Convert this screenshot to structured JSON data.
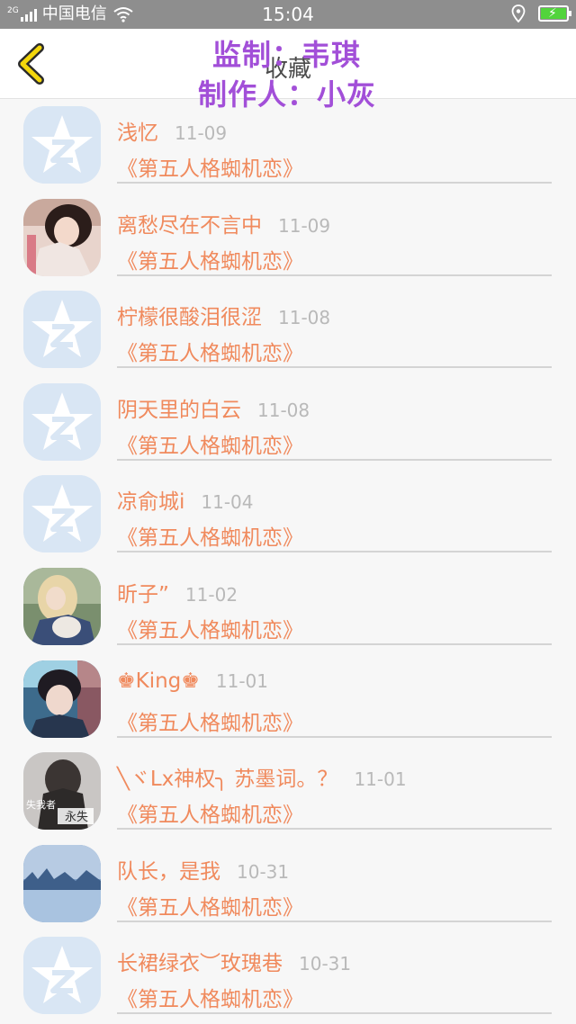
{
  "status_bar": {
    "network_tag": "2G",
    "carrier": "中国电信",
    "time": "15:04"
  },
  "header": {
    "title": "收藏",
    "overlay_line1": "监制：韦琪",
    "overlay_line2": "制作人：小灰",
    "overlay_color": "#a24fd8"
  },
  "colors": {
    "accent_orange": "#f08a5d",
    "back_arrow": "#f2d60c",
    "date_gray": "#b9b9b9"
  },
  "favorites": [
    {
      "name": "浅忆",
      "date": "11-09",
      "game": "《第五人格蜘机恋》",
      "avatar": "default-qzone-star-icon"
    },
    {
      "name": "离愁尽在不言中",
      "date": "11-09",
      "game": "《第五人格蜘机恋》",
      "avatar": "photo"
    },
    {
      "name": "柠檬很酸泪很涩",
      "date": "11-08",
      "game": "《第五人格蜘机恋》",
      "avatar": "default-qzone-star-icon"
    },
    {
      "name": "阴天里的白云",
      "date": "11-08",
      "game": "《第五人格蜘机恋》",
      "avatar": "default-qzone-star-icon"
    },
    {
      "name": "凉俞城i",
      "date": "11-04",
      "game": "《第五人格蜘机恋》",
      "avatar": "default-qzone-star-icon"
    },
    {
      "name": "昕子”",
      "date": "11-02",
      "game": "《第五人格蜘机恋》",
      "avatar": "photo"
    },
    {
      "name": "♚King♚",
      "date": "11-01",
      "game": "《第五人格蜘机恋》",
      "avatar": "photo"
    },
    {
      "name": "╲ヾLx神权╮ 苏墨词。？",
      "date": "11-01",
      "game": "《第五人格蜘机恋》",
      "avatar": "photo",
      "avatar_caption_1": "失我者",
      "avatar_caption_2": "永失"
    },
    {
      "name": "队长，是我",
      "date": "10-31",
      "game": "《第五人格蜘机恋》",
      "avatar": "photo"
    },
    {
      "name": "长裙绿衣︶玫瑰巷",
      "date": "10-31",
      "game": "《第五人格蜘机恋》",
      "avatar": "default-qzone-star-icon"
    }
  ]
}
